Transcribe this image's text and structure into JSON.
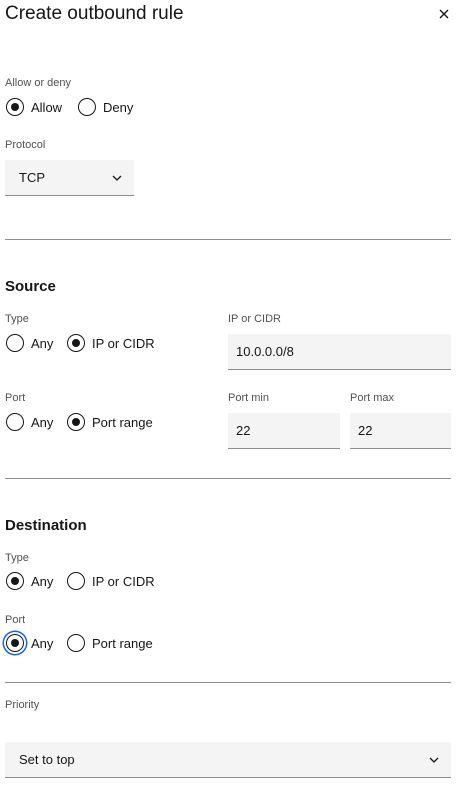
{
  "header": {
    "title": "Create outbound rule"
  },
  "allow_deny": {
    "label": "Allow or deny",
    "options": [
      "Allow",
      "Deny"
    ],
    "selected": "Allow"
  },
  "protocol": {
    "label": "Protocol",
    "value": "TCP"
  },
  "source": {
    "title": "Source",
    "type_label": "Type",
    "type_options": [
      "Any",
      "IP or CIDR"
    ],
    "type_selected": "IP or CIDR",
    "ip_label": "IP or CIDR",
    "ip_value": "10.0.0.0/8",
    "port_label": "Port",
    "port_options": [
      "Any",
      "Port range"
    ],
    "port_selected": "Port range",
    "port_min_label": "Port min",
    "port_min_value": "22",
    "port_max_label": "Port max",
    "port_max_value": "22"
  },
  "destination": {
    "title": "Destination",
    "type_label": "Type",
    "type_options": [
      "Any",
      "IP or CIDR"
    ],
    "type_selected": "Any",
    "port_label": "Port",
    "port_options": [
      "Any",
      "Port range"
    ],
    "port_selected": "Any"
  },
  "priority": {
    "label": "Priority",
    "value": "Set to top"
  },
  "icons": {
    "close": "close-icon",
    "chevron": "chevron-down-icon"
  },
  "colors": {
    "text": "#161616",
    "muted": "#525252",
    "field_bg": "#f4f4f4",
    "border": "#8d8d8d",
    "focus": "#0f62fe"
  }
}
